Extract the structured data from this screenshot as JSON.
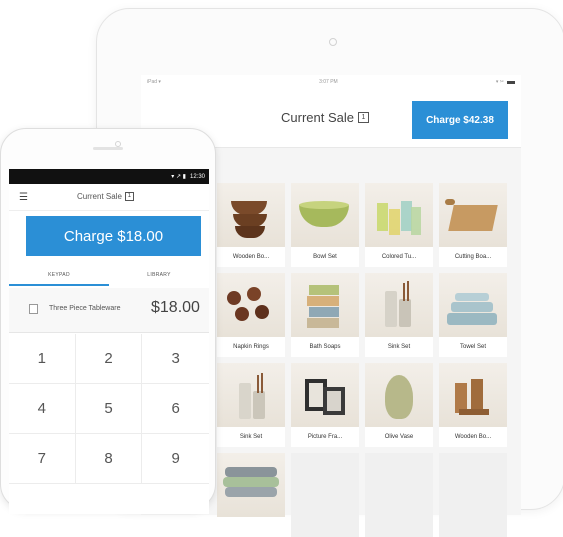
{
  "tablet": {
    "status": {
      "left": "iPad ▾",
      "time": "3:07 PM",
      "right": "▾ ✂"
    },
    "header": {
      "title": "Current Sale",
      "badge": "1",
      "charge_label": "Charge $42.38"
    },
    "items": [
      {
        "label": "Wooden Bo...",
        "icon": "wooden-bowls"
      },
      {
        "label": "Bowl Set",
        "icon": "bowl"
      },
      {
        "label": "Colored Tu...",
        "icon": "tumblers"
      },
      {
        "label": "Cutting Boa...",
        "icon": "cutting-board"
      },
      {
        "label": "Napkin Rings",
        "icon": "napkin-rings"
      },
      {
        "label": "Bath Soaps",
        "icon": "soaps"
      },
      {
        "label": "Sink Set",
        "icon": "sink-set"
      },
      {
        "label": "Towel Set",
        "icon": "towels"
      },
      {
        "label": "Sink Set",
        "icon": "sink-set"
      },
      {
        "label": "Picture Fra...",
        "icon": "picture-frames"
      },
      {
        "label": "Olive Vase",
        "icon": "vase"
      },
      {
        "label": "Wooden Bo...",
        "icon": "wooden-boxes"
      },
      {
        "label": "",
        "icon": "stacked-cushions"
      }
    ]
  },
  "phone": {
    "status": {
      "icons": "▾ ↗ ▮",
      "time": "12:30"
    },
    "header": {
      "menu_icon": "☰",
      "title": "Current Sale",
      "badge": "1"
    },
    "charge_label": "Charge $18.00",
    "tabs": [
      {
        "label": "KEYPAD"
      },
      {
        "label": "LIBRARY"
      }
    ],
    "line_item": {
      "name": "Three Piece Tableware",
      "price": "$18.00"
    },
    "keypad": [
      "1",
      "2",
      "3",
      "4",
      "5",
      "6",
      "7",
      "8",
      "9"
    ]
  },
  "colors": {
    "accent": "#2b8fd6"
  }
}
